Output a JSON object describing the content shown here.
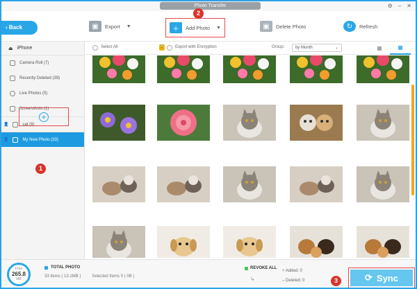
{
  "window": {
    "title": "Photo Transfer",
    "accent": "#2aa1e6"
  },
  "toolbar": {
    "back_label": "Back",
    "export_label": "Export",
    "add_photo_label": "Add Photo",
    "delete_photo_label": "Delete Photo",
    "refresh_label": "Refresh"
  },
  "sidebar": {
    "device": "iPhone",
    "items": [
      {
        "label": "Camera Roll (7)",
        "icon": "camera-icon"
      },
      {
        "label": "Recently Deleted (39)",
        "icon": "clock-icon"
      },
      {
        "label": "Live Photos (5)",
        "icon": "live-icon"
      },
      {
        "label": "Screenshots (1)",
        "icon": "screenshot-icon"
      }
    ],
    "albums": [
      {
        "label": "cat (9)",
        "active": false
      },
      {
        "label": "My New Photo (33)",
        "active": true
      }
    ]
  },
  "filters": {
    "select_all": "Select All",
    "export_encryption": "Export with Encryption",
    "group_label": "Group:",
    "group_value": "by Month"
  },
  "photos": {
    "rows": [
      [
        "flowers",
        "flowers",
        "flowers",
        "flowers",
        "flowers"
      ],
      [
        "purple-flowers",
        "pink-dahlia",
        "cat",
        "two-cats",
        "cat"
      ],
      [
        "kittens",
        "kittens",
        "cat",
        "kittens",
        "cat"
      ],
      [
        "cat",
        "puppy",
        "puppy",
        "puppies",
        "puppies"
      ]
    ]
  },
  "status": {
    "storage_label": "Free",
    "storage_value": "265.8",
    "storage_unit": "MB",
    "total_label": "TOTAL PHOTO",
    "items": "33 items ( 13.1MB )",
    "selected": "Selected Items 0 ( 0B )",
    "revoke": "REVOKE ALL",
    "added": "Added: 0",
    "deleted": "Deleted: 0"
  },
  "sync_label": "Sync",
  "steps": [
    "1",
    "2",
    "3"
  ]
}
